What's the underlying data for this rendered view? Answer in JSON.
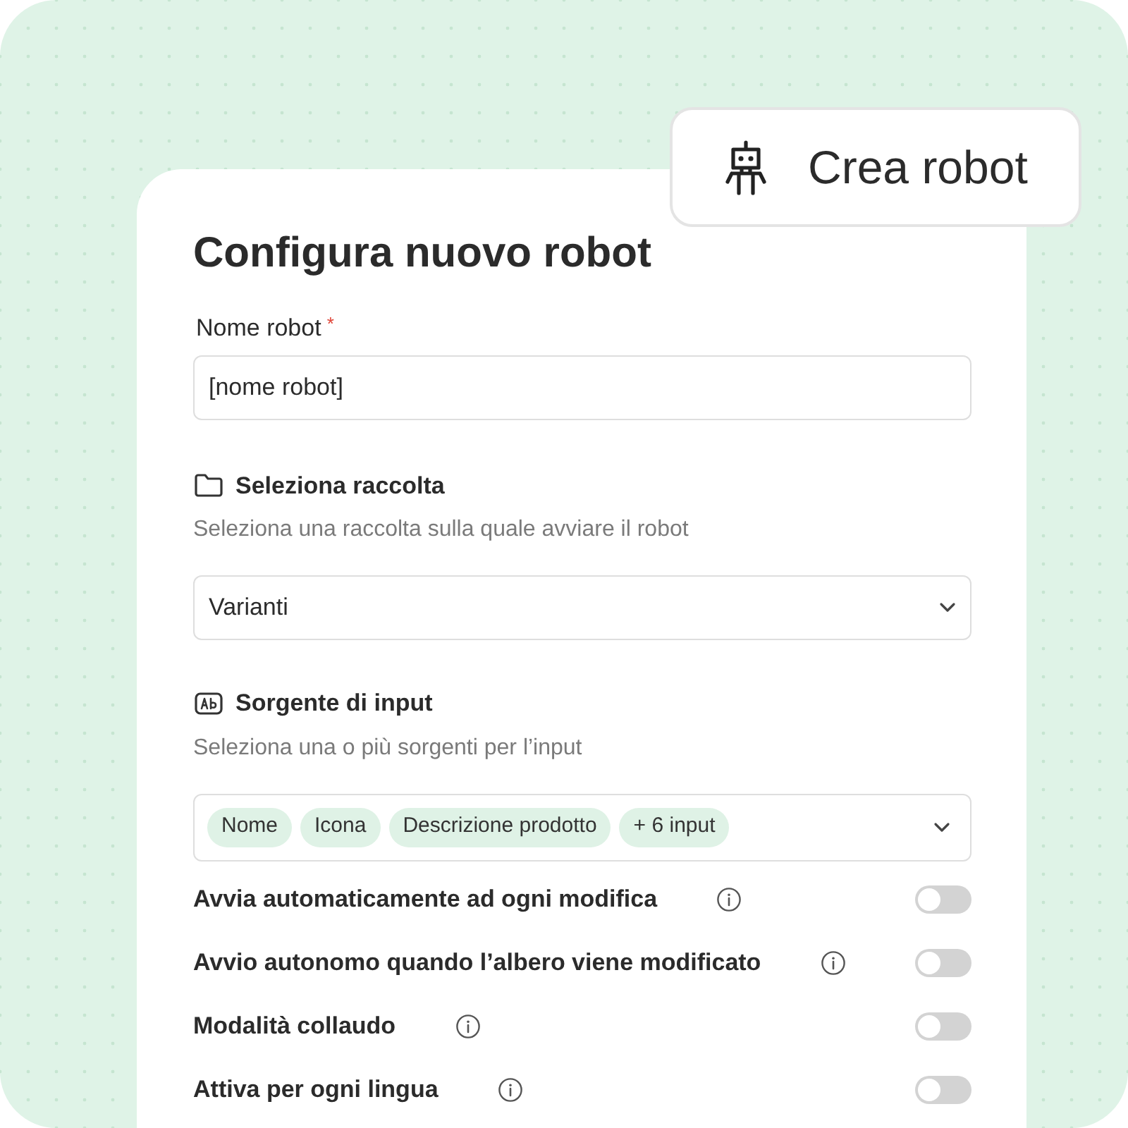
{
  "create_button": {
    "label": "Crea robot"
  },
  "form": {
    "title": "Configura nuovo robot",
    "name_field": {
      "label": "Nome robot",
      "required": true,
      "required_mark": "*",
      "value": "[nome robot]"
    },
    "collection": {
      "title": "Seleziona raccolta",
      "description": "Seleziona una raccolta sulla quale avviare il robot",
      "value": "Varianti"
    },
    "input_source": {
      "title": "Sorgente di input",
      "description": "Seleziona una o più sorgenti per l’input",
      "chips": [
        "Nome",
        "Icona",
        "Descrizione prodotto",
        "+ 6 input"
      ]
    },
    "toggles": [
      {
        "label": "Avvia automaticamente ad ogni modifica",
        "on": false
      },
      {
        "label": "Avvio autonomo quando l’albero viene modificato",
        "on": false
      },
      {
        "label": "Modalità collaudo",
        "on": false
      },
      {
        "label": "Attiva per ogni lingua",
        "on": false
      }
    ]
  }
}
